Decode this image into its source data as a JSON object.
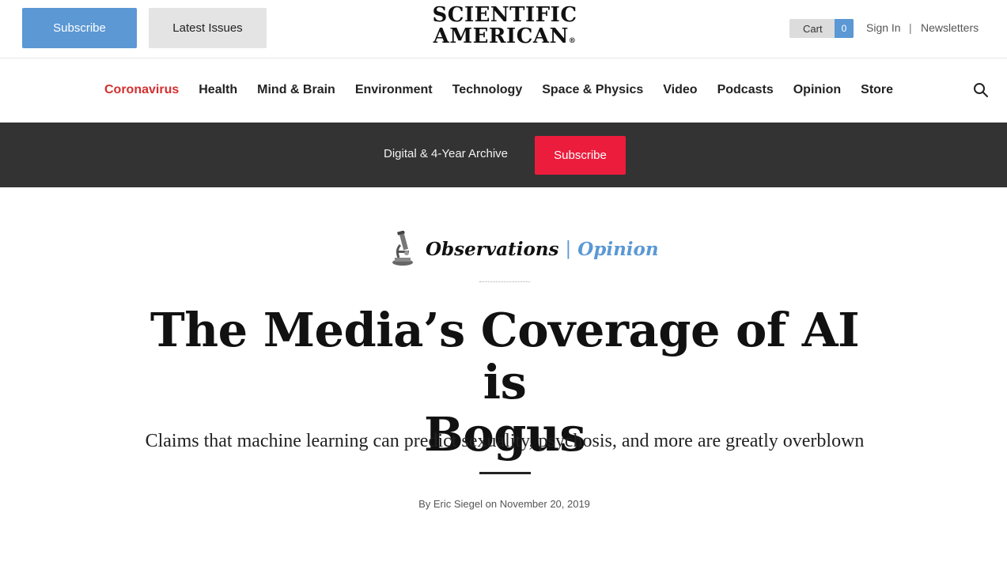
{
  "header": {
    "subscribe_label": "Subscribe",
    "latest_issues_label": "Latest Issues",
    "logo_line1": "SCIENTIFIC",
    "logo_line2": "AMERICAN",
    "logo_reg": "®",
    "cart_label": "Cart",
    "cart_count": "0",
    "sign_in_label": "Sign In",
    "separator": "|",
    "newsletters_label": "Newsletters"
  },
  "nav": {
    "items": [
      {
        "label": "Coronavirus",
        "active": true
      },
      {
        "label": "Health"
      },
      {
        "label": "Mind & Brain"
      },
      {
        "label": "Environment"
      },
      {
        "label": "Technology"
      },
      {
        "label": "Space & Physics"
      },
      {
        "label": "Video"
      },
      {
        "label": "Podcasts"
      },
      {
        "label": "Opinion"
      },
      {
        "label": "Store"
      }
    ],
    "search_icon": "search-icon"
  },
  "promo": {
    "text": "Digital & 4-Year Archive",
    "button_label": "Subscribe"
  },
  "article": {
    "column_icon": "microscope-icon",
    "column_name": "Observations",
    "column_separator": "|",
    "column_type": "Opinion",
    "title_line1": "The Media’s Coverage of AI is",
    "title_line2": "Bogus",
    "dek": "Claims that machine learning can predict sexuality, psychosis, and more are greatly overblown",
    "byline_prefix": "By",
    "author": "Eric Siegel",
    "date_prefix": "on",
    "date": "November 20, 2019"
  },
  "colors": {
    "accent_blue": "#5b98d4",
    "accent_red": "#d32f2f",
    "promo_button": "#ec1c3d",
    "promo_band": "#333333"
  }
}
